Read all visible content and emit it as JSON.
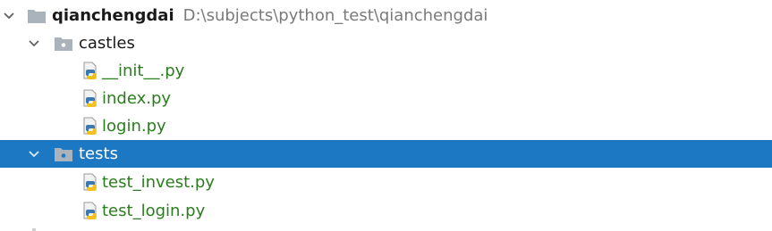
{
  "project": {
    "name": "qianchengdai",
    "path": "D:\\subjects\\python_test\\qianchengdai"
  },
  "folders": [
    {
      "name": "castles",
      "files": [
        "__init__.py",
        "index.py",
        "login.py"
      ]
    },
    {
      "name": "tests",
      "selected": true,
      "files": [
        "test_invest.py",
        "test_login.py"
      ]
    }
  ],
  "colors": {
    "selection": "#1d78c4",
    "python_file_text": "#2a7d1e",
    "path_text": "#7a7a7a",
    "folder_icon": "#aab2bb"
  }
}
